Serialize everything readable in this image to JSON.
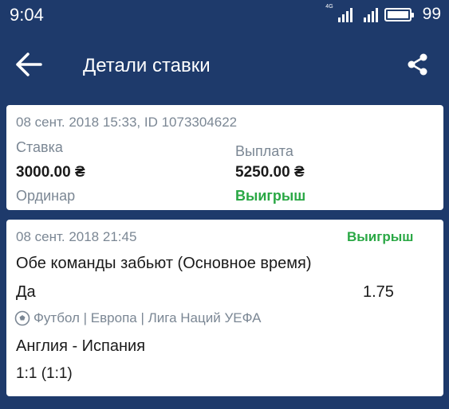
{
  "status_bar": {
    "time": "9:04",
    "network": "4G",
    "battery": "99"
  },
  "header": {
    "title": "Детали ставки",
    "back_icon": "arrow-left-icon",
    "share_icon": "share-icon"
  },
  "bet_summary": {
    "datetime_id": "08 сент. 2018 15:33, ID 1073304622",
    "stake_label": "Ставка",
    "stake_value": "3000.00 ₴",
    "bet_type": "Ординар",
    "payout_label": "Выплата",
    "payout_value": "5250.00 ₴",
    "result": "Выигрыш"
  },
  "event": {
    "datetime": "08 сент. 2018 21:45",
    "result": "Выигрыш",
    "market": "Обе команды забьют (Основное время)",
    "selection": "Да",
    "odds": "1.75",
    "sport_icon": "soccer-ball-icon",
    "league": "Футбол | Европа | Лига Наций УЕФА",
    "teams": "Англия - Испания",
    "score": "1:1 (1:1)"
  },
  "colors": {
    "background": "#1e3a6b",
    "card": "#ffffff",
    "win": "#2aa845",
    "muted": "#7b8794"
  }
}
